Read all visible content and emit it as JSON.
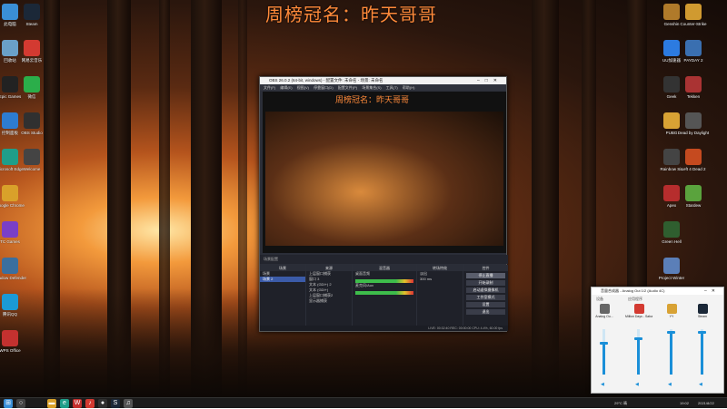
{
  "wallpaper_title": "周榜冠名：昨天哥哥",
  "desktop_left": [
    {
      "label": "此电脑",
      "icon": "computer-icon",
      "color": "#3a8fd6"
    },
    {
      "label": "回收站",
      "icon": "recycle-bin-icon",
      "color": "#6aa0c8"
    },
    {
      "label": "Epic Games",
      "icon": "epic-icon",
      "color": "#222"
    },
    {
      "label": "控制面板",
      "icon": "control-panel-icon",
      "color": "#2d7cd1"
    },
    {
      "label": "Microsoft Edge",
      "icon": "edge-icon",
      "color": "#1f9e89"
    },
    {
      "label": "Google Chrome",
      "icon": "chrome-icon",
      "color": "#d9a12a"
    },
    {
      "label": "TC Games",
      "icon": "tc-games-icon",
      "color": "#7a3fc7"
    },
    {
      "label": "Shadow Defender",
      "icon": "shadow-icon",
      "color": "#3b6f9e"
    },
    {
      "label": "腾讯QQ",
      "icon": "qq-icon",
      "color": "#1b9ad6"
    },
    {
      "label": "WPS Office",
      "icon": "wps-icon",
      "color": "#c4312f"
    },
    {
      "label": "Steam",
      "icon": "steam-icon",
      "color": "#1b2838"
    },
    {
      "label": "网易云音乐",
      "icon": "netease-music-icon",
      "color": "#d33a31"
    },
    {
      "label": "微信",
      "icon": "wechat-icon",
      "color": "#2bae4a"
    },
    {
      "label": "OBS Studio",
      "icon": "obs-icon",
      "color": "#303030"
    },
    {
      "label": "Welcome",
      "icon": "welcome-icon",
      "color": "#444"
    }
  ],
  "desktop_right": [
    {
      "label": "Genshin",
      "icon": "genshin-icon",
      "color": "#b07a2a"
    },
    {
      "label": "UU加速器",
      "icon": "uu-icon",
      "color": "#2c7be0"
    },
    {
      "label": "Geek",
      "icon": "geek-icon",
      "color": "#333"
    },
    {
      "label": "PUBG",
      "icon": "pubg-icon",
      "color": "#d8a234"
    },
    {
      "label": "Rainbow Six",
      "icon": "r6-icon",
      "color": "#444"
    },
    {
      "label": "Apex",
      "icon": "apex-icon",
      "color": "#b62d2d"
    },
    {
      "label": "Green Hell",
      "icon": "green-hell-icon",
      "color": "#2f5e2f"
    },
    {
      "label": "Project Winter",
      "icon": "project-winter-icon",
      "color": "#5b7fb8"
    },
    {
      "label": "Don't Starve",
      "icon": "dont-starve-icon",
      "color": "#6b4c2b"
    },
    {
      "label": "Far Cry 5",
      "icon": "farcry-icon",
      "color": "#c76b2a"
    },
    {
      "label": "Counter-Strike",
      "icon": "cs-icon",
      "color": "#d09a30"
    },
    {
      "label": "PAYDAY 2",
      "icon": "payday-icon",
      "color": "#3a6fb0"
    },
    {
      "label": "Tekken",
      "icon": "tekken-icon",
      "color": "#a33"
    },
    {
      "label": "Dead by Daylight",
      "icon": "dbd-icon",
      "color": "#555"
    },
    {
      "label": "Left 4 Dead 2",
      "icon": "l4d-icon",
      "color": "#c54a1f"
    },
    {
      "label": "Stardew",
      "icon": "stardew-icon",
      "color": "#5aa33d"
    }
  ],
  "obs": {
    "title": "OBS 26.0.2 (64-bit, windows) - 配置文件: 未命名 - 场景: 未命名",
    "menu": "文件(F) 编辑(E) 视图(V) 停靠窗口(D) 配置文件(P) 场景集合(S) 工具(T) 帮助(H)",
    "preview_watermark": "周榜冠名：昨天哥哥",
    "scene_bar": "场景配置",
    "docks": {
      "scenes": {
        "header": "场景",
        "items": [
          "场景",
          "场景 2"
        ]
      },
      "sources": {
        "header": "来源",
        "items": [
          "上层窗口捕获",
          "窗口 3",
          "文本 (GDI+) 2",
          "文本 (GDI+)",
          "上层窗口捕获2",
          "显示器捕获"
        ]
      },
      "mixer": {
        "header": "混音器",
        "channels": [
          "桌面音频",
          "麦克风/Aux"
        ]
      },
      "transitions": {
        "header": "转场特效",
        "type": "淡出",
        "duration": "300 ms"
      },
      "controls": {
        "header": "控件",
        "buttons": [
          "停止直播",
          "开始录制",
          "启动虚拟摄像机",
          "工作室模式",
          "设置",
          "退出"
        ]
      }
    },
    "status": "LIVE: 00:32:40   REC: 00:00:00   CPU: 4.4%, 60.00 fps"
  },
  "volume_mixer": {
    "title": "音量合成器 - Analog Out 1/2 (Audio 4C)",
    "section_device": "设备",
    "section_apps": "应用程序",
    "channels": [
      {
        "label": "Analog Ou...",
        "icon": "speaker-device-icon",
        "color": "#666",
        "level": 0.68
      },
      {
        "label": "Million Days - Sabai/Hoang/Cl...",
        "icon": "netease-music-icon",
        "color": "#d33a31",
        "level": 0.78
      },
      {
        "label": "YY",
        "icon": "yy-icon",
        "color": "#d8a234",
        "level": 0.92
      },
      {
        "label": "Steam",
        "icon": "steam-icon",
        "color": "#1b2838",
        "level": 0.92
      }
    ]
  },
  "taskbar": {
    "apps": [
      {
        "icon": "start-icon",
        "color": "#3a8fd6",
        "glyph": "⊞"
      },
      {
        "icon": "search-icon",
        "color": "#444",
        "glyph": "○"
      },
      {
        "icon": "file-explorer-icon",
        "color": "#d9a12a",
        "glyph": "▬"
      },
      {
        "icon": "edge-icon",
        "color": "#1f9e89",
        "glyph": "e"
      },
      {
        "icon": "wps-icon",
        "color": "#c4312f",
        "glyph": "W"
      },
      {
        "icon": "netease-music-icon",
        "color": "#d33a31",
        "glyph": "♪"
      },
      {
        "icon": "obs-icon",
        "color": "#303030",
        "glyph": "●"
      },
      {
        "icon": "steam-icon",
        "color": "#1b2838",
        "glyph": "S"
      },
      {
        "icon": "volume-mixer-icon",
        "color": "#555",
        "glyph": "♫"
      }
    ],
    "weather": "29°C 晴",
    "time": "19:02",
    "date": "2021/8/22"
  }
}
